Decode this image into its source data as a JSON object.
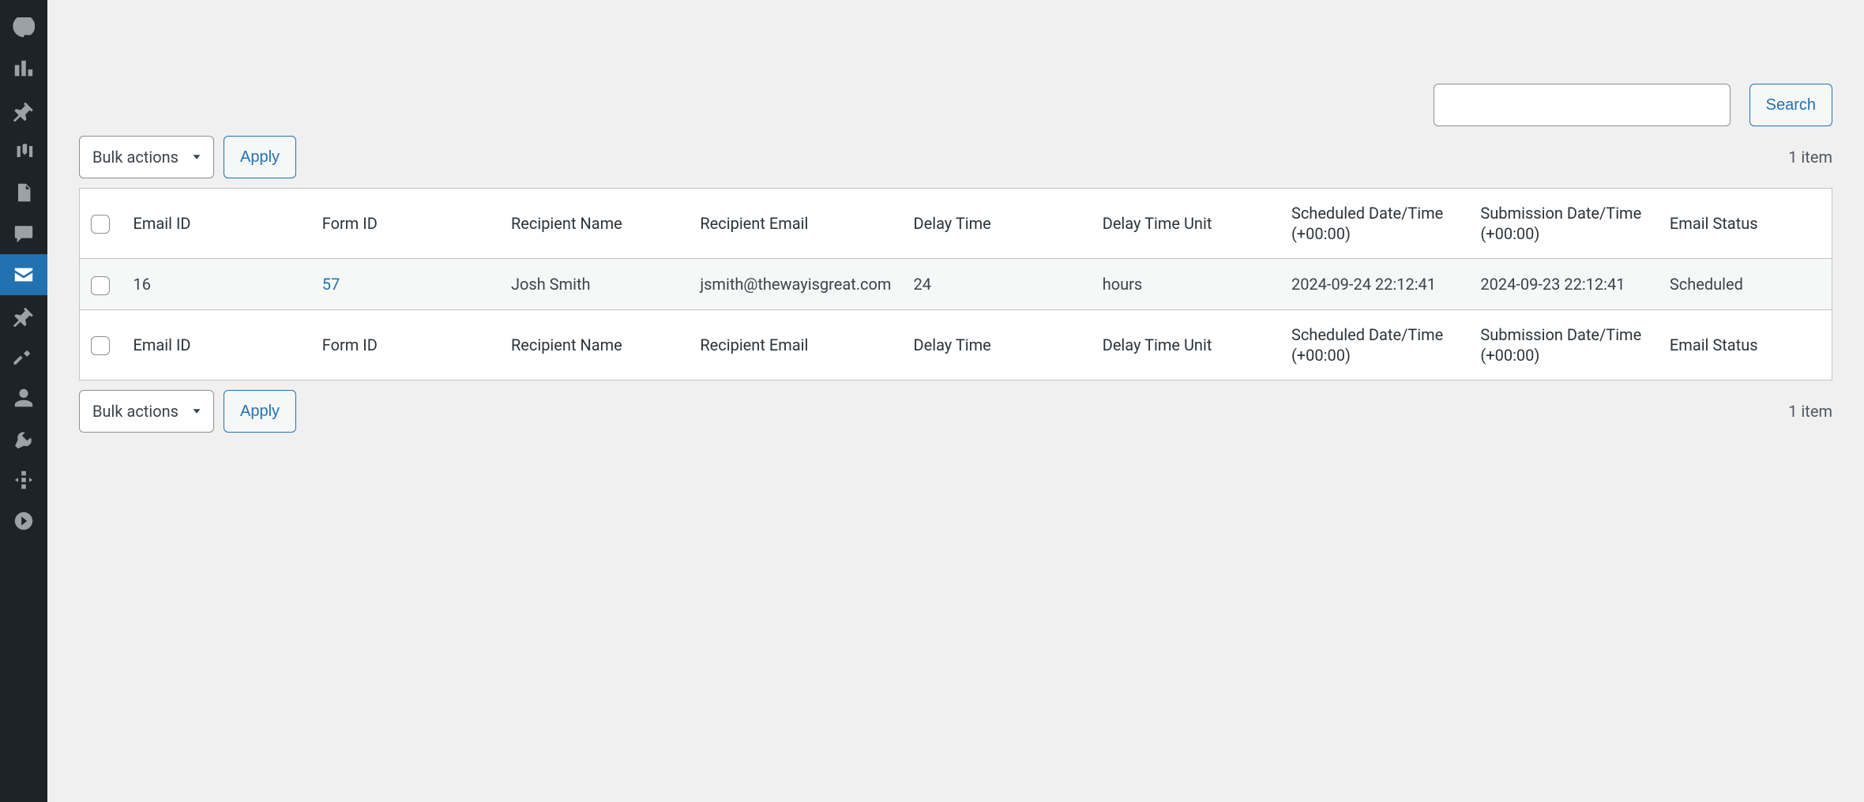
{
  "search": {
    "button": "Search",
    "value": ""
  },
  "toolbar": {
    "bulk_actions": "Bulk actions",
    "apply": "Apply",
    "item_count": "1 item"
  },
  "columns": {
    "email_id": "Email ID",
    "form_id": "Form ID",
    "recipient_name": "Recipient Name",
    "recipient_email": "Recipient Email",
    "delay_time": "Delay Time",
    "delay_unit": "Delay Time Unit",
    "scheduled": "Scheduled Date/Time (+00:00)",
    "submission": "Submission Date/Time (+00:00)",
    "status": "Email Status"
  },
  "rows": [
    {
      "email_id": "16",
      "form_id": "57",
      "recipient_name": "Josh Smith",
      "recipient_email": "jsmith@thewayisgreat.com",
      "delay_time": "24",
      "delay_unit": "hours",
      "scheduled": "2024-09-24 22:12:41",
      "submission": "2024-09-23 22:12:41",
      "status": "Scheduled"
    }
  ],
  "nav": {
    "active": "mail"
  }
}
